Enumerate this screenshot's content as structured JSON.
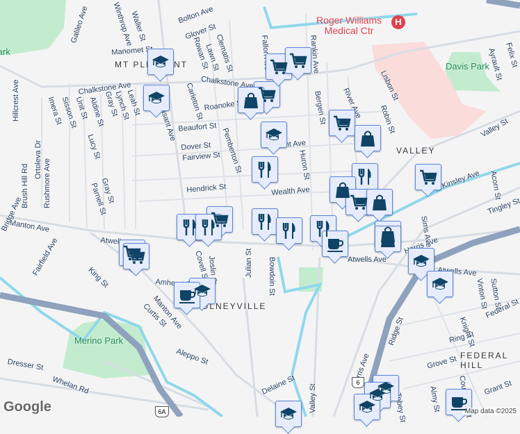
{
  "map": {
    "attribution": "Map data ©2025",
    "logo": "Google",
    "colors": {
      "background": "#f5f4f5",
      "road": "#d7dde4",
      "highway": "#8ea2bd",
      "water": "#8fd8ec",
      "park": "#c3eccf",
      "hospital_area": "#fadcdb",
      "marker_bg": "#e6ecfb",
      "marker_icon": "#0f4466",
      "poi_red": "#e2404c"
    },
    "poi": {
      "name_line1": "Roger Williams",
      "name_line2": "Medical Ctr",
      "icon": "hospital-icon"
    },
    "neighborhoods": [
      "MT PLEASANT",
      "VALLEY",
      "OLNEYVILLE",
      "FEDERAL HILL"
    ],
    "parks": [
      "Davis Park",
      "Merino Park",
      "Park"
    ],
    "streets": [
      "Bolton Ave",
      "Glover St",
      "Manomet St",
      "Winthrop Ave",
      "Waller St",
      "Galileo Ave",
      "Chalkstone Ave",
      "Chalkstone Ave",
      "Roanoke St",
      "Beaufort St",
      "Dover St",
      "Fairview St",
      "Hendrick St",
      "Pleasant Ave",
      "Carleton St",
      "Rowan St",
      "Lawn St",
      "Clematis St",
      "Pemberton St",
      "Hillcrest Ave",
      "Ortoleva Dr",
      "Imera St",
      "Sisson St",
      "Unit St",
      "Aldine St",
      "Gray St",
      "Lynch St",
      "Leah St",
      "Lucy St",
      "Parnell St",
      "Gray St",
      "Brush Hill Rd",
      "Rushmore Ave",
      "Manton Ave",
      "Fairfield Ave",
      "Atwells Ave",
      "Atwells Ave",
      "Atwells Ave",
      "King St",
      "Amherst St",
      "Covell St",
      "Joslin St",
      "Julian St",
      "Bowdoin St",
      "Curtis St",
      "Manton Ave",
      "Aleppo St",
      "Dresser St",
      "Whelan Rd",
      "Delaine St",
      "Valley St",
      "Harris Ave",
      "Harris Ave",
      "Ridge St",
      "Ring St",
      "Grove St",
      "Federal St",
      "Knight St",
      "Vinton St",
      "Sutton St",
      "Grant St",
      "Almy St",
      "Courtland St",
      "Tobey St",
      "Rankin Ave",
      "Bergen St",
      "River Ave",
      "Lisbon St",
      "Robin St",
      "Huron St",
      "Regent Ave",
      "Wealth Ave",
      "Valley St",
      "Kinsley Ave",
      "Ayrault St",
      "Felix St",
      "Acorn St",
      "Sims Ave",
      "Tingley St",
      "Fallon Ave",
      "Bridge Ave"
    ],
    "shields": [
      "6",
      "6A"
    ],
    "markers": [
      "school-icon",
      "school-icon",
      "shopping-cart-icon",
      "shopping-bag-icon",
      "shopping-cart-icon",
      "shopping-cart-icon",
      "school-icon",
      "shopping-cart-icon",
      "shopping-bag-icon",
      "dining-icon",
      "dining-icon",
      "shopping-bag-icon",
      "shopping-cart-icon",
      "shopping-bag-icon",
      "shopping-cart-icon",
      "shopping-cart-icon",
      "dining-icon",
      "dining-icon",
      "dining-icon",
      "dining-icon",
      "dining-icon",
      "shopping-bag-icon",
      "coffee-icon",
      "shopping-bag-icon",
      "shopping-cart-icon",
      "shopping-cart-icon",
      "school-icon",
      "coffee-icon",
      "school-icon",
      "school-icon",
      "school-icon",
      "school-icon",
      "school-icon",
      "school-icon",
      "coffee-icon"
    ]
  }
}
